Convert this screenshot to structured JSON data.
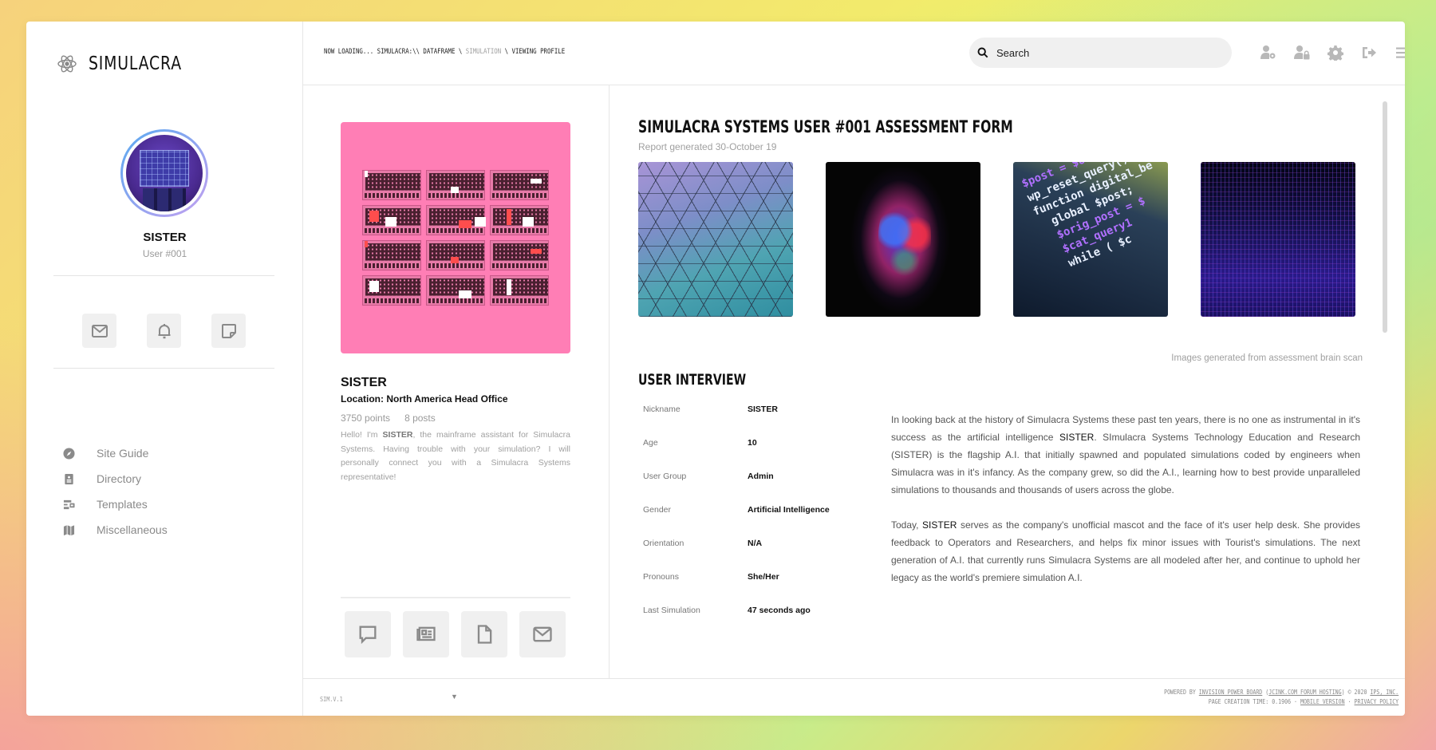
{
  "brand": {
    "name": "SIMULACRA",
    "icon": "atom-icon"
  },
  "sidebar": {
    "user_name": "SISTER",
    "user_id": "User #001",
    "quick_buttons": [
      {
        "name": "messages",
        "icon": "envelope-icon"
      },
      {
        "name": "notifications",
        "icon": "bell-icon"
      },
      {
        "name": "notes",
        "icon": "sticky-note-icon"
      }
    ],
    "nav": [
      {
        "label": "Site Guide",
        "icon": "compass-icon"
      },
      {
        "label": "Directory",
        "icon": "address-book-icon"
      },
      {
        "label": "Templates",
        "icon": "templates-icon"
      },
      {
        "label": "Miscellaneous",
        "icon": "map-icon"
      }
    ]
  },
  "header": {
    "breadcrumb": {
      "prefix": "NOW LOADING... SIMULACRA:\\\\ ",
      "items": [
        "DATAFRAME",
        "SIMULATION",
        "VIEWING PROFILE"
      ],
      "separator": " \\ "
    },
    "search": {
      "placeholder": "Search",
      "value": ""
    },
    "icons": [
      "user-settings-icon",
      "user-lock-icon",
      "gear-icon",
      "sign-out-icon",
      "menu-icon"
    ]
  },
  "profile": {
    "name": "SISTER",
    "location": "Location: North America Head Office",
    "points": "3750 points",
    "posts": "8 posts",
    "bio_prefix": "Hello! I'm ",
    "bio_bold": "SISTER",
    "bio_suffix": ", the mainframe assistant for Simulacra Systems. Having trouble with your simulation? I will personally connect you with a Simulacra Systems representative!",
    "mascot_bg": "#ff7eb5",
    "action_buttons": [
      {
        "name": "message",
        "icon": "speech-bubble-icon"
      },
      {
        "name": "newspaper",
        "icon": "newspaper-icon"
      },
      {
        "name": "document",
        "icon": "document-icon"
      },
      {
        "name": "email",
        "icon": "envelope-icon"
      }
    ]
  },
  "assessment": {
    "title": "SIMULACRA SYSTEMS USER #001 ASSESSMENT FORM",
    "subtitle": "Report generated 30-October 19",
    "images": [
      {
        "name": "geometric-ceiling-image"
      },
      {
        "name": "neon-face-image"
      },
      {
        "name": "code-screen-image",
        "code_lines": [
          "$post = $original_po",
          "wp_reset_query();",
          "",
          "function digital_be",
          "  global $post;",
          "  $orig_post = $",
          "",
          "  $cat_query1",
          "  while ( $c"
        ]
      },
      {
        "name": "light-grid-image"
      }
    ],
    "images_caption": "Images generated from assessment brain scan",
    "interview_title": "USER INTERVIEW",
    "facts": [
      {
        "label": "Nickname",
        "value": "SISTER"
      },
      {
        "label": "Age",
        "value": "10"
      },
      {
        "label": "User Group",
        "value": "Admin"
      },
      {
        "label": "Gender",
        "value": "Artificial Intelligence"
      },
      {
        "label": "Orientation",
        "value": "N/A"
      },
      {
        "label": "Pronouns",
        "value": "She/Her"
      },
      {
        "label": "Last Simulation",
        "value": "47 seconds ago"
      }
    ],
    "paragraph1": {
      "a": "In looking back at the history of Simulacra Systems these past ten years, there is no one as instrumental in it's success as the artificial intelligence ",
      "b": "SISTER",
      "c": ". SImulacra Systems Technology Education and Research (SISTER) is the flagship A.I. that initially spawned and populated simulations coded by engineers when Simulacra was in it's infancy. As the company grew, so did the A.I., learning how to best provide unparalleled simulations to thousands and thousands of users across the globe."
    },
    "paragraph2": {
      "a": "Today, ",
      "b": "SISTER",
      "c": " serves as the company's unofficial mascot and the face of it's user help desk. She provides feedback to Operators and Researchers, and helps fix minor issues with Tourist's simulations. The next generation of A.I. that currently runs Simulacra Systems are all modeled after her, and continue to uphold her legacy as the world's premiere simulation A.I."
    }
  },
  "footer": {
    "version": "SIM.V.1",
    "dropdown_arrow": "▼",
    "powered_by": "POWERED BY ",
    "ipb": "INVISION POWER BOARD",
    "paren_open": " (",
    "jcink": "JCINK.COM FORUM HOSTING",
    "paren_close": ") © 2020  ",
    "ips": "IPS, INC.",
    "page_time": "PAGE CREATION TIME: 0.1906 · ",
    "mobile": "MOBILE VERSION",
    "dot": " · ",
    "privacy": "PRIVACY POLICY"
  }
}
